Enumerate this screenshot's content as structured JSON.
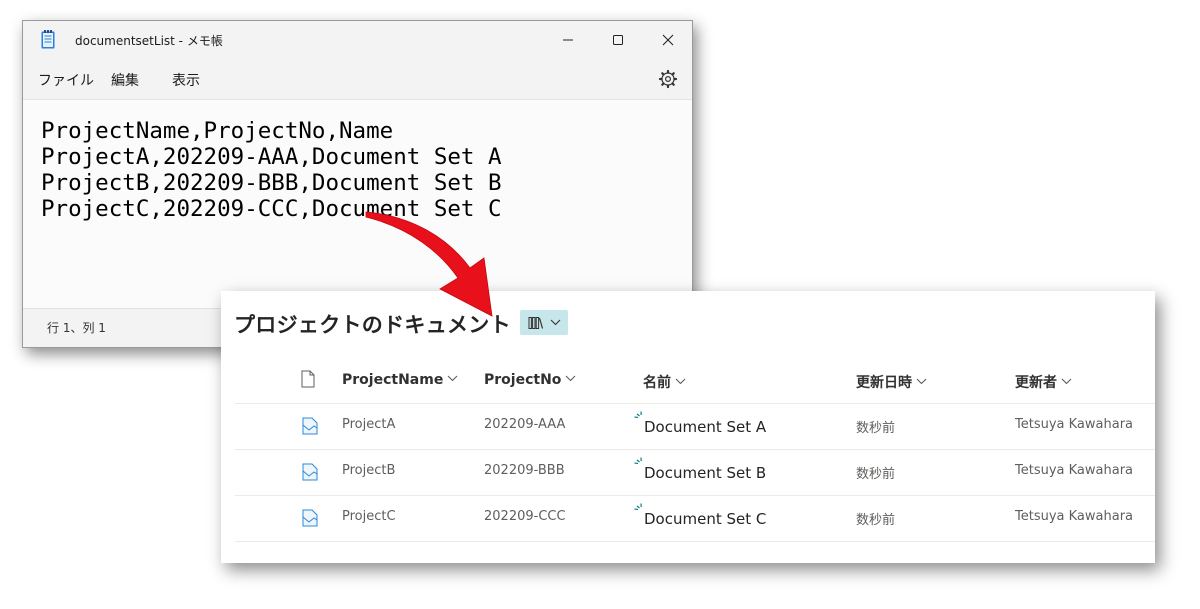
{
  "notepad": {
    "title": "documentsetList - メモ帳",
    "menu": {
      "file": "ファイル",
      "edit": "編集",
      "view": "表示"
    },
    "lines": [
      "ProjectName,ProjectNo,Name",
      "ProjectA,202209-AAA,Document Set A",
      "ProjectB,202209-BBB,Document Set B",
      "ProjectC,202209-CCC,Document Set C"
    ],
    "status": "行 1、列 1"
  },
  "library": {
    "title": "プロジェクトのドキュメント",
    "columns": {
      "project_name": "ProjectName",
      "project_no": "ProjectNo",
      "name": "名前",
      "modified": "更新日時",
      "modified_by": "更新者"
    },
    "rows": [
      {
        "project_name": "ProjectA",
        "project_no": "202209-AAA",
        "name": "Document Set A",
        "modified": "数秒前",
        "modified_by": "Tetsuya Kawahara"
      },
      {
        "project_name": "ProjectB",
        "project_no": "202209-BBB",
        "name": "Document Set B",
        "modified": "数秒前",
        "modified_by": "Tetsuya Kawahara"
      },
      {
        "project_name": "ProjectC",
        "project_no": "202209-CCC",
        "name": "Document Set C",
        "modified": "数秒前",
        "modified_by": "Tetsuya Kawahara"
      }
    ]
  },
  "colors": {
    "arrow": "#e8101a",
    "accent": "#038387",
    "view_switch_bg": "#c7e6ec"
  }
}
